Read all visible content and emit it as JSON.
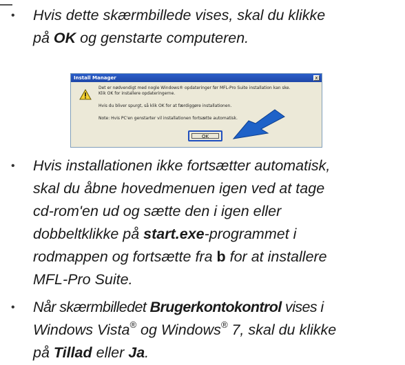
{
  "bullet_symbol": "•",
  "item1": {
    "l1_before": "Hvis dette skærmbillede vises, skal du klikke",
    "l2_before": "på ",
    "l2_bold": "OK",
    "l2_after": " og genstarte computeren."
  },
  "dialog": {
    "title": "Install Manager",
    "close_glyph": "x",
    "line1": "Det er nødvendigt med nogle Windows® opdateringer før MFL-Pro Suite installation kan ske.",
    "line2": "Klik OK for installere opdateringerne.",
    "line3": "Hvis du bliver spurgt, så klik OK for at færdiggøre installationen.",
    "line4": "Note: Hvis PC'en genstarter vil installationen fortsætte automatisk.",
    "ok_label": "OK"
  },
  "item2": {
    "l1": "Hvis installationen ikke fortsætter automatisk,",
    "l2": "skal du åbne hovedmenuen igen ved at tage",
    "l3": "cd-rom'en ud og sætte den i igen eller",
    "l4_before": "dobbeltklikke på ",
    "l4_bold": "start.exe",
    "l4_after": "-programmet i",
    "l5_before": "rodmappen og fortsætte fra ",
    "l5_bold": "b",
    "l5_after": " for at installere",
    "l6": "MFL-Pro Suite."
  },
  "item3": {
    "l1_before": "Når skærmbilledet ",
    "l1_bold": "Brugerkontokontrol",
    "l1_after": " vises i",
    "l2_a": "Windows Vista",
    "l2_sup1": "®",
    "l2_b": " og Windows",
    "l2_sup2": "®",
    "l2_c": " 7, skal du klikke",
    "l3_before": "på ",
    "l3_bold1": "Tillad",
    "l3_mid": " eller ",
    "l3_bold2": "Ja",
    "l3_after": "."
  }
}
